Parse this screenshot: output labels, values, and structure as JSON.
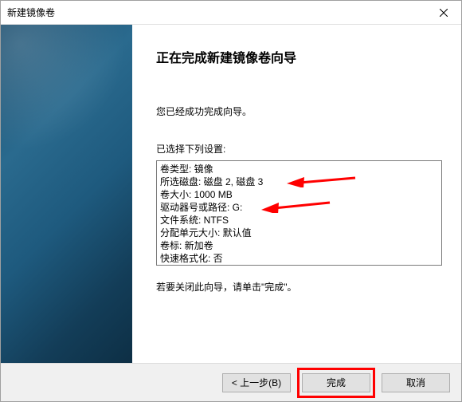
{
  "window": {
    "title": "新建镜像卷"
  },
  "content": {
    "heading": "正在完成新建镜像卷向导",
    "completed_msg": "您已经成功完成向导。",
    "settings_label": "已选择下列设置:",
    "close_hint": "若要关闭此向导，请单击\"完成\"。"
  },
  "settings_list": [
    "卷类型: 镜像",
    "所选磁盘: 磁盘 2, 磁盘 3",
    "卷大小: 1000 MB",
    "驱动器号或路径: G:",
    "文件系统: NTFS",
    "分配单元大小: 默认值",
    "卷标: 新加卷",
    "快速格式化: 否"
  ],
  "buttons": {
    "back": "< 上一步(B)",
    "finish": "完成",
    "cancel": "取消"
  },
  "annotations": {
    "arrow_color": "#ff0000",
    "highlight_color": "#ff0000"
  }
}
